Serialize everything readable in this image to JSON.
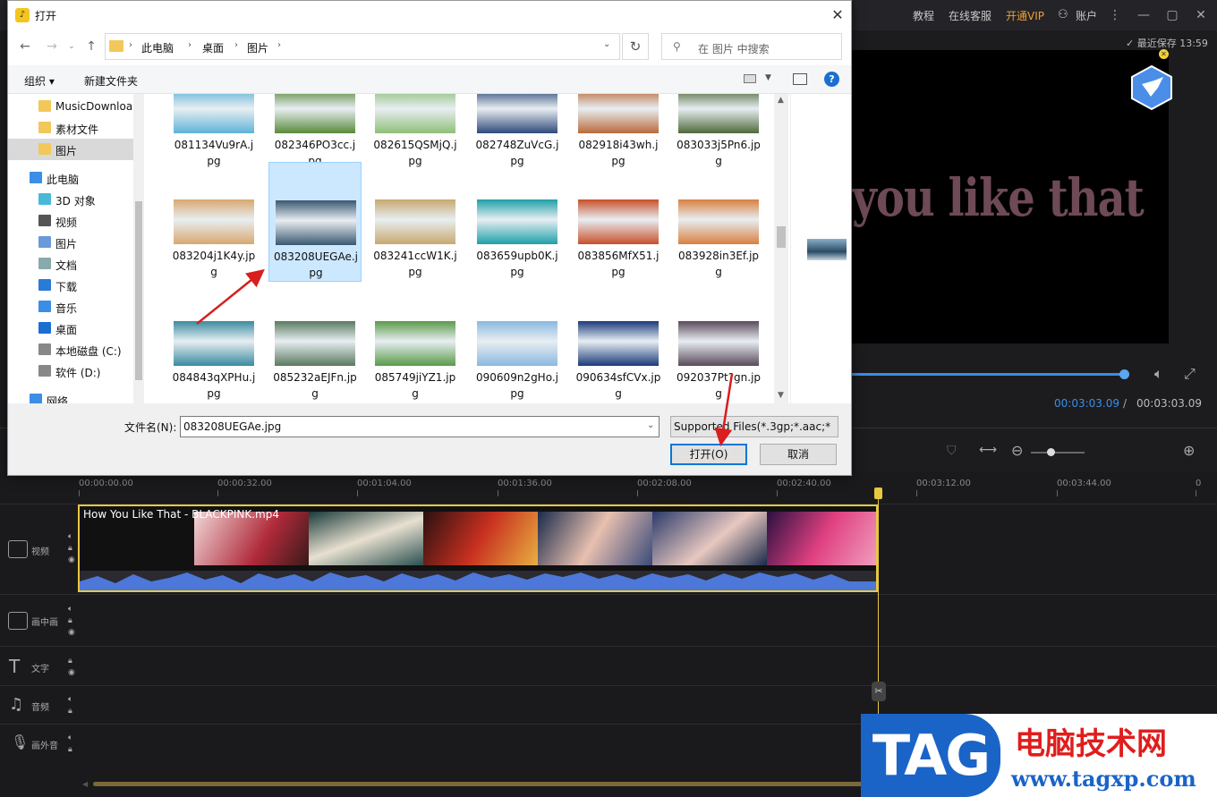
{
  "topbar": {
    "links": [
      "教程",
      "在线客服",
      "开通VIP",
      "账户"
    ],
    "save_status": "最近保存 13:59"
  },
  "preview": {
    "overlay_text": "you like that",
    "time_current": "00:03:03.09",
    "time_separator": "/",
    "time_total": "00:03:03.09",
    "progress": 1.0
  },
  "timeline": {
    "ruler": [
      "00:00:00.00",
      "00:00:32.00",
      "00:01:04.00",
      "00:01:36.00",
      "00:02:08.00",
      "00:02:40.00",
      "00:03:12.00",
      "00:03:44.00",
      "0"
    ],
    "tracks": [
      "视频",
      "画中画",
      "文字",
      "音频",
      "画外音"
    ],
    "clip_title": "How You Like That - BLACKPINK.mp4"
  },
  "dialog": {
    "title": "打开",
    "breadcrumbs": [
      "此电脑",
      "桌面",
      "图片"
    ],
    "search_placeholder": "在 图片 中搜索",
    "organize": "组织",
    "new_folder": "新建文件夹",
    "nav_items": [
      {
        "label": "MusicDownloa",
        "icon": "folder-icon"
      },
      {
        "label": "素材文件",
        "icon": "folder-icon"
      },
      {
        "label": "图片",
        "icon": "folder-icon",
        "selected": true
      },
      {
        "label": "此电脑",
        "icon": "computer-icon"
      },
      {
        "label": "3D 对象",
        "icon": "3d-objects-icon"
      },
      {
        "label": "视频",
        "icon": "video-icon"
      },
      {
        "label": "图片",
        "icon": "pictures-icon"
      },
      {
        "label": "文档",
        "icon": "documents-icon"
      },
      {
        "label": "下载",
        "icon": "download-icon"
      },
      {
        "label": "音乐",
        "icon": "music-icon"
      },
      {
        "label": "桌面",
        "icon": "desktop-icon"
      },
      {
        "label": "本地磁盘 (C:)",
        "icon": "drive-icon"
      },
      {
        "label": "软件 (D:)",
        "icon": "drive-icon"
      },
      {
        "label": "网络",
        "icon": "network-icon"
      }
    ],
    "files": [
      [
        "081134Vu9rA.jpg",
        "082346PO3cc.jpg",
        "082615QSMjQ.jpg",
        "082748ZuVcG.jpg",
        "082918i43wh.jpg",
        "083033j5Pn6.jpg"
      ],
      [
        "083204j1K4y.jpg",
        "083208UEGAe.jpg",
        "083241ccW1K.jpg",
        "083659upb0K.jpg",
        "083856MfX51.jpg",
        "083928in3Ef.jpg"
      ],
      [
        "084843qXPHu.jpg",
        "085232aEJFn.jpg",
        "085749jiYZ1.jpg",
        "090609n2gHo.jpg",
        "090634sfCVx.jpg",
        "092037Pt?gn.jpg"
      ]
    ],
    "file_colors": [
      [
        "#5fb3d8",
        "#5a8a3a",
        "#8fbf7a",
        "#2e4a7a",
        "#b86a3a",
        "#4e6a3a"
      ],
      [
        "#d8a870",
        "#3a5870",
        "#c8a870",
        "#1ea0a8",
        "#c8502a",
        "#d88040"
      ],
      [
        "#3a8aa0",
        "#5a7a60",
        "#5a9a4a",
        "#8ab8e0",
        "#1a3a7a",
        "#5a4a5a"
      ]
    ],
    "filename_label": "文件名(N):",
    "filename_value": "083208UEGAe.jpg",
    "filetype_value": "Supported Files(*.3gp;*.aac;*",
    "open_button": "打开(O)",
    "cancel_button": "取消"
  },
  "watermark": {
    "tag": "TAG",
    "cn": "电脑技术网",
    "url": "www.tagxp.com"
  },
  "colors": {
    "accent": "#3a8ee6",
    "vip": "#f0a030",
    "clip_border": "#e8c840",
    "arrow": "#d81e1e"
  }
}
